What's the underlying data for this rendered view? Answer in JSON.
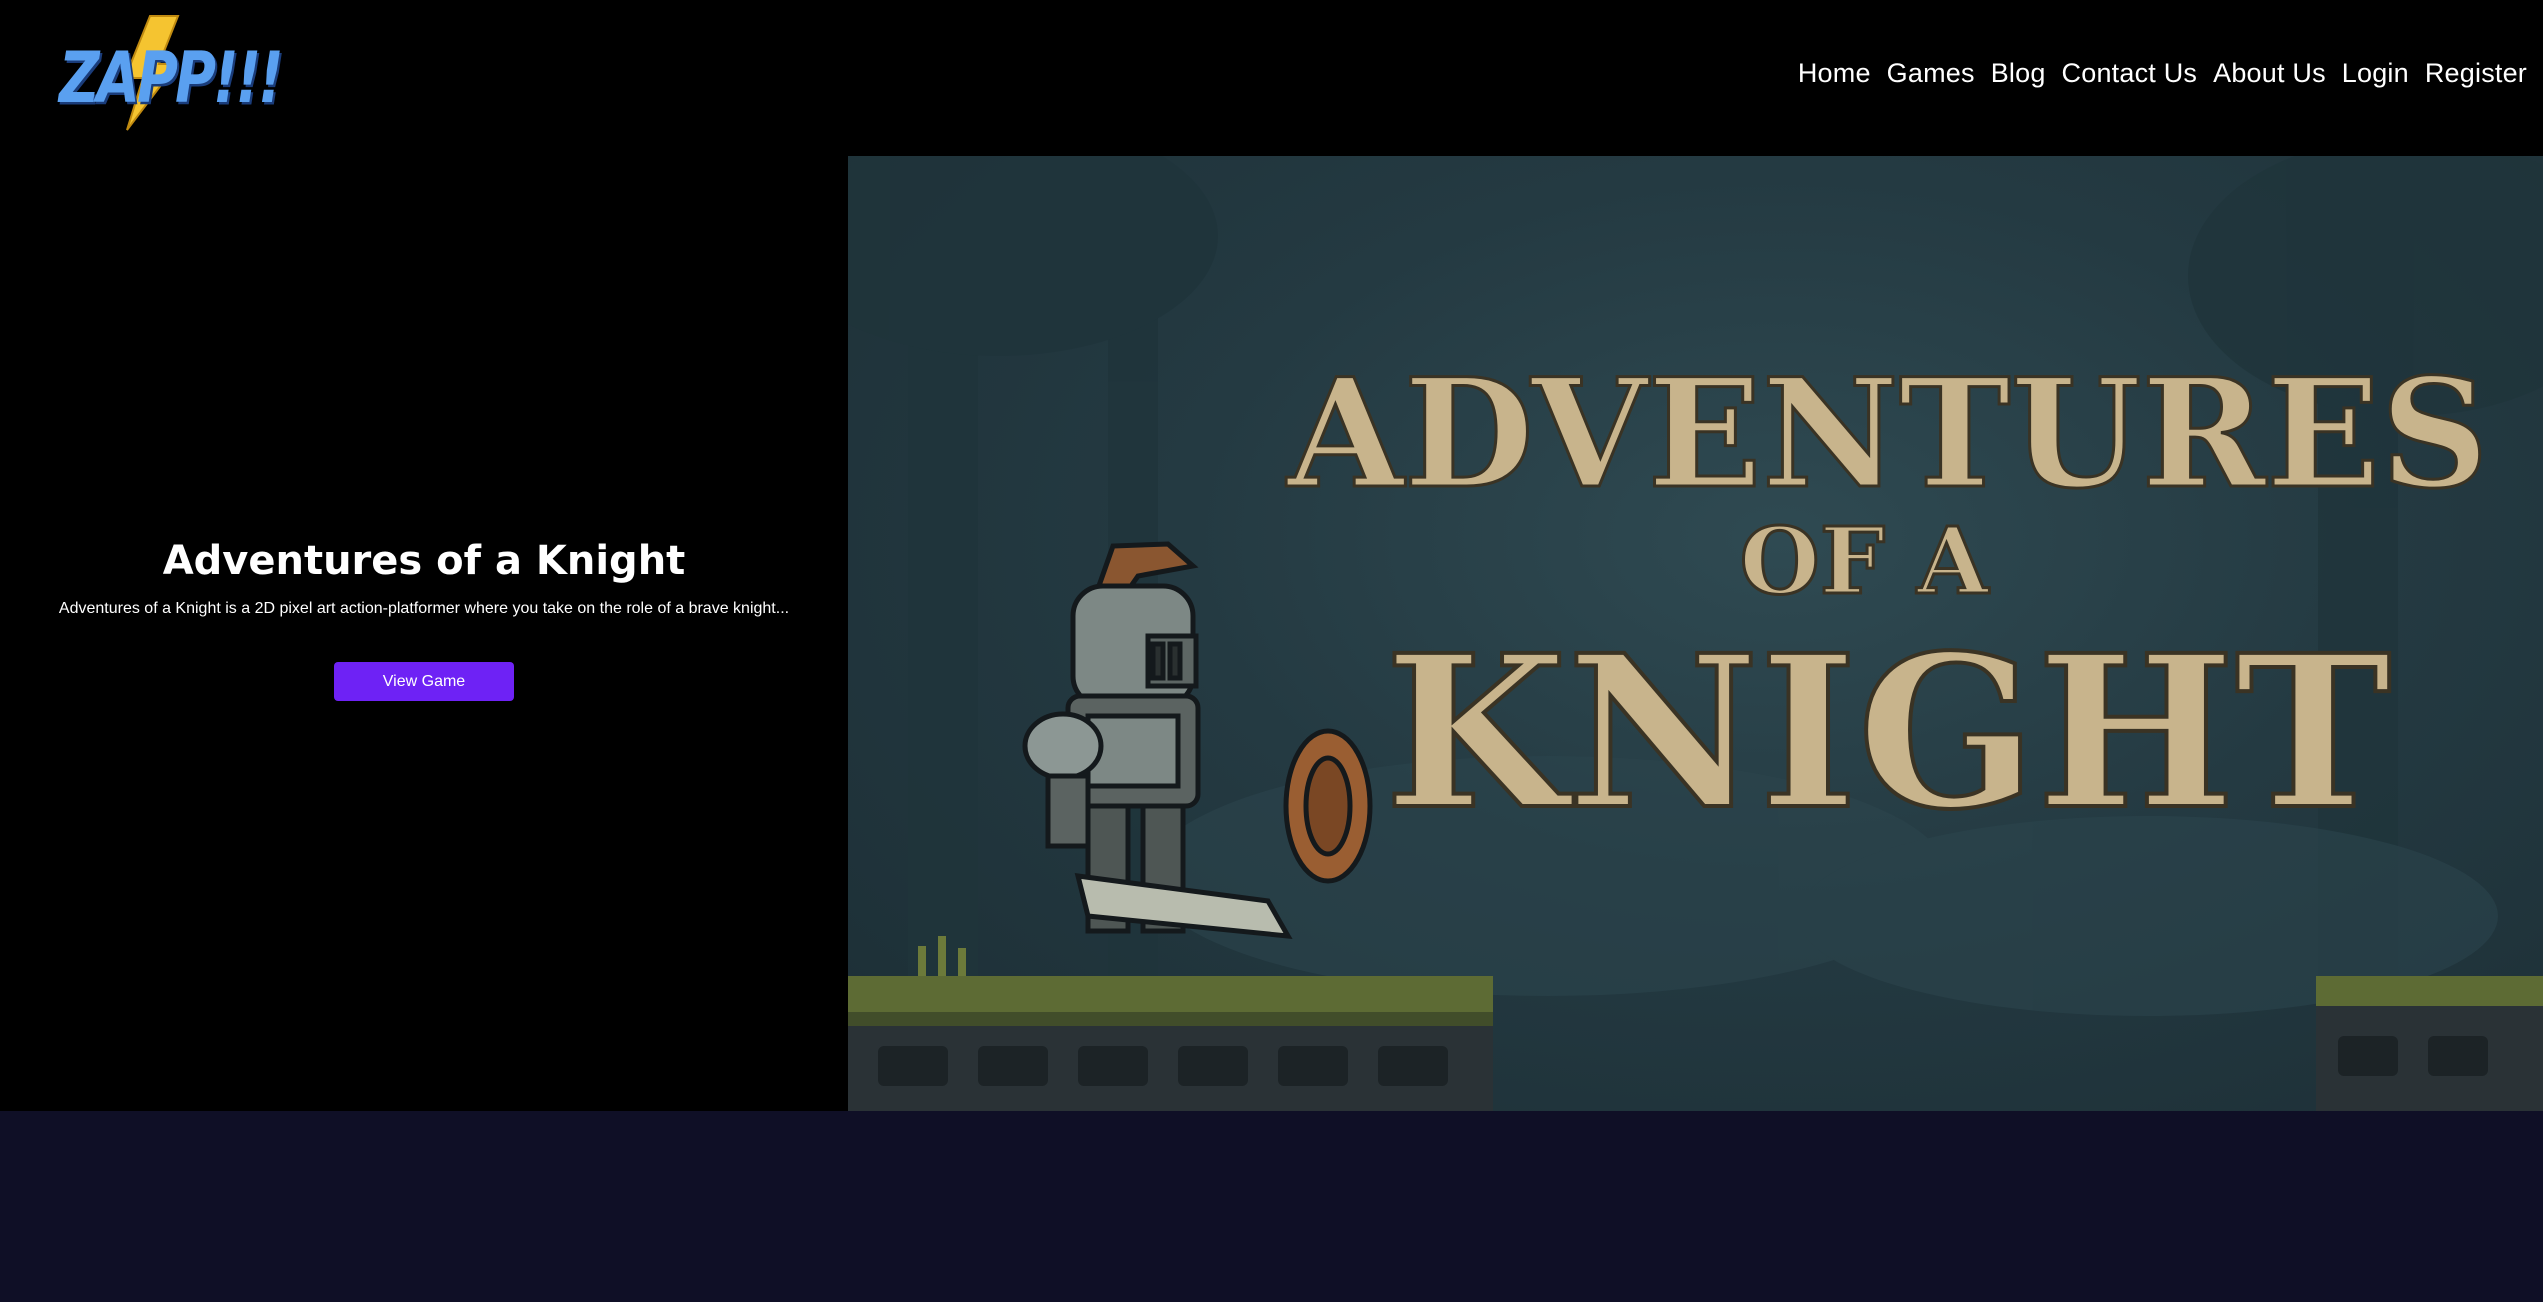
{
  "header": {
    "logo": {
      "text": "ZAPP!!!",
      "icon": "lightning-bolt-icon",
      "colors": {
        "text": "#5aa0f0",
        "bolt": "#f5c430"
      }
    },
    "nav": [
      "Home",
      "Games",
      "Blog",
      "Contact Us",
      "About Us",
      "Login",
      "Register"
    ]
  },
  "hero": {
    "title": "Adventures of a Knight",
    "description": "Adventures of a Knight is a 2D pixel art action-platformer where you take on the role of a brave knight...",
    "button_label": "View Game",
    "button_color": "#6e22f5",
    "image": {
      "title_line1": "ADVENTURES",
      "title_line2": "OF A",
      "title_line3": "KNIGHT",
      "title_color": "#c8b48c"
    }
  },
  "colors": {
    "background": "#000000",
    "footer_band": "#0f0f26"
  }
}
